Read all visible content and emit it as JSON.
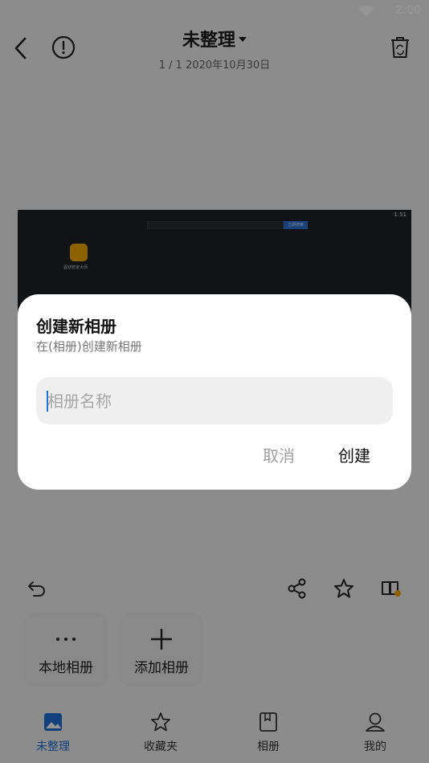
{
  "status_bar": {
    "time": "2:00"
  },
  "header": {
    "title": "未整理",
    "subtitle": "1 / 1  2020年10月30日"
  },
  "photo": {
    "time": "1:51",
    "search_button": "立即搜索",
    "app_label": "驱动管家大师"
  },
  "albums": [
    {
      "label": "本地相册",
      "icon": "more-icon"
    },
    {
      "label": "添加相册",
      "icon": "plus-icon"
    }
  ],
  "tabs": [
    {
      "label": "未整理",
      "icon": "photo-icon",
      "active": true
    },
    {
      "label": "收藏夹",
      "icon": "star-icon",
      "active": false
    },
    {
      "label": "相册",
      "icon": "album-icon",
      "active": false
    },
    {
      "label": "我的",
      "icon": "user-icon",
      "active": false
    }
  ],
  "dialog": {
    "title": "创建新相册",
    "subtitle": "在(相册)创建新相册",
    "input_placeholder": "相册名称",
    "input_value": "",
    "cancel_label": "取消",
    "create_label": "创建"
  },
  "colors": {
    "accent": "#1f6fd6",
    "scrim": "rgba(0,0,0,0.42)"
  }
}
